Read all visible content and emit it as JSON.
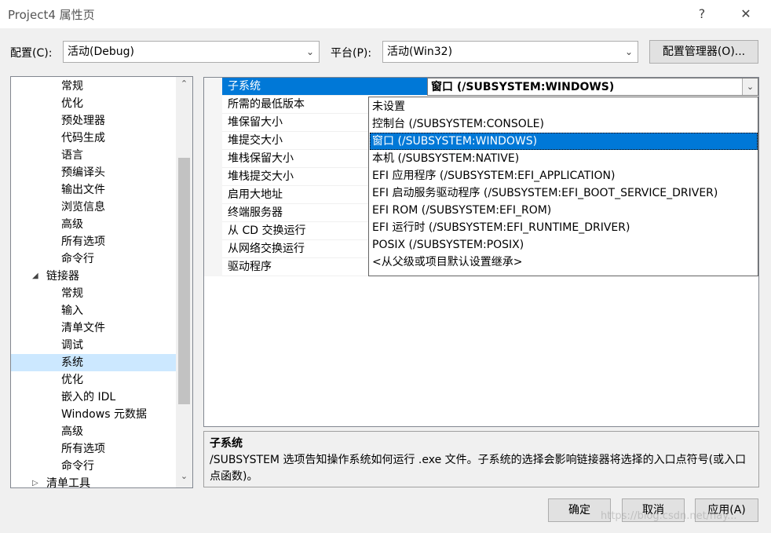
{
  "window": {
    "title": "Project4 属性页",
    "help_label": "?",
    "close_label": "✕"
  },
  "config_bar": {
    "config_label": "配置(C):",
    "config_value": "活动(Debug)",
    "platform_label": "平台(P):",
    "platform_value": "活动(Win32)",
    "manager_button": "配置管理器(O)..."
  },
  "tree": {
    "items": [
      {
        "label": "常规",
        "level": 2
      },
      {
        "label": "优化",
        "level": 2
      },
      {
        "label": "预处理器",
        "level": 2
      },
      {
        "label": "代码生成",
        "level": 2
      },
      {
        "label": "语言",
        "level": 2
      },
      {
        "label": "预编译头",
        "level": 2
      },
      {
        "label": "输出文件",
        "level": 2
      },
      {
        "label": "浏览信息",
        "level": 2
      },
      {
        "label": "高级",
        "level": 2
      },
      {
        "label": "所有选项",
        "level": 2
      },
      {
        "label": "命令行",
        "level": 2
      },
      {
        "label": "链接器",
        "level": 1,
        "expanded": true
      },
      {
        "label": "常规",
        "level": 2
      },
      {
        "label": "输入",
        "level": 2
      },
      {
        "label": "清单文件",
        "level": 2
      },
      {
        "label": "调试",
        "level": 2
      },
      {
        "label": "系统",
        "level": 2,
        "selected": true
      },
      {
        "label": "优化",
        "level": 2
      },
      {
        "label": "嵌入的 IDL",
        "level": 2
      },
      {
        "label": "Windows 元数据",
        "level": 2
      },
      {
        "label": "高级",
        "level": 2
      },
      {
        "label": "所有选项",
        "level": 2
      },
      {
        "label": "命令行",
        "level": 2
      },
      {
        "label": "清单工具",
        "level": 1,
        "expanded": false
      }
    ]
  },
  "properties": {
    "rows": [
      {
        "name": "子系统",
        "value": "窗口 (/SUBSYSTEM:WINDOWS)",
        "selected": true
      },
      {
        "name": "所需的最低版本",
        "value": ""
      },
      {
        "name": "堆保留大小",
        "value": ""
      },
      {
        "name": "堆提交大小",
        "value": ""
      },
      {
        "name": "堆栈保留大小",
        "value": ""
      },
      {
        "name": "堆栈提交大小",
        "value": ""
      },
      {
        "name": "启用大地址",
        "value": ""
      },
      {
        "name": "终端服务器",
        "value": ""
      },
      {
        "name": "从 CD 交换运行",
        "value": ""
      },
      {
        "name": "从网络交换运行",
        "value": ""
      },
      {
        "name": "驱动程序",
        "value": ""
      }
    ]
  },
  "dropdown": {
    "options": [
      "未设置",
      "控制台 (/SUBSYSTEM:CONSOLE)",
      "窗口 (/SUBSYSTEM:WINDOWS)",
      "本机 (/SUBSYSTEM:NATIVE)",
      "EFI 应用程序 (/SUBSYSTEM:EFI_APPLICATION)",
      "EFI 启动服务驱动程序 (/SUBSYSTEM:EFI_BOOT_SERVICE_DRIVER)",
      "EFI ROM (/SUBSYSTEM:EFI_ROM)",
      "EFI 运行时 (/SUBSYSTEM:EFI_RUNTIME_DRIVER)",
      "POSIX (/SUBSYSTEM:POSIX)",
      "<从父级或项目默认设置继承>"
    ],
    "selected_index": 2
  },
  "description": {
    "title": "子系统",
    "text": "/SUBSYSTEM 选项告知操作系统如何运行 .exe 文件。子系统的选择会影响链接器将选择的入口点符号(或入口点函数)。"
  },
  "buttons": {
    "ok": "确定",
    "cancel": "取消",
    "apply": "应用(A)"
  },
  "watermark": "https://blog.csdn.net/hay..."
}
